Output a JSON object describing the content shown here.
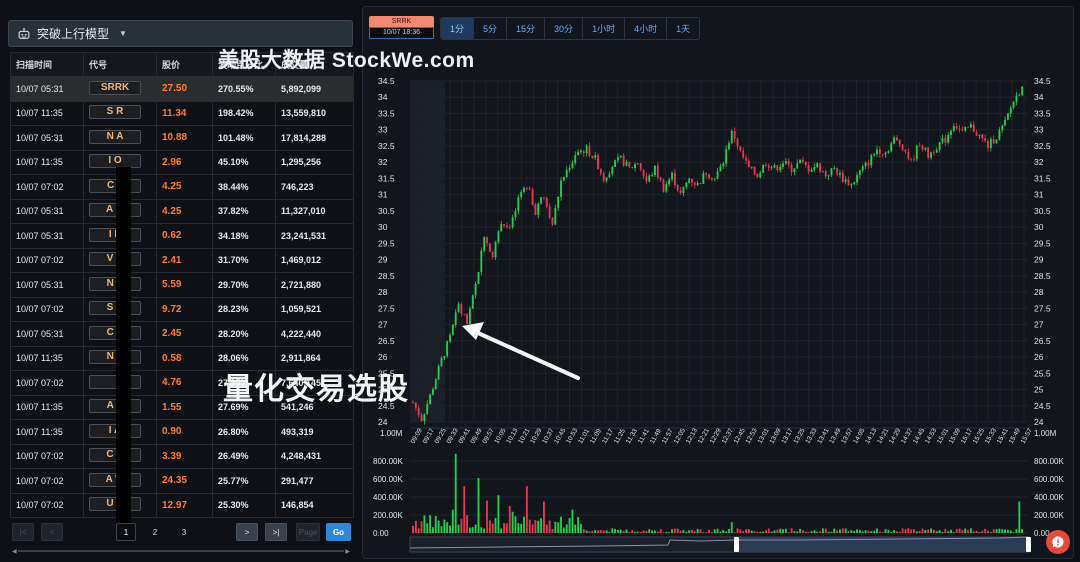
{
  "model": {
    "label": "突破上行模型",
    "icon": "robot-icon"
  },
  "table": {
    "headers": [
      "扫描时间",
      "代号",
      "股价",
      "波动百分比",
      "成交量"
    ],
    "rows": [
      {
        "time": "10/07 05:31",
        "code": "SRRK",
        "price": "27.50",
        "pct": "270.55%",
        "vol": "5,892,099"
      },
      {
        "time": "10/07 11:35",
        "code": "S    R",
        "price": "11.34",
        "pct": "198.42%",
        "vol": "13,559,810"
      },
      {
        "time": "10/07 05:31",
        "code": "N    A",
        "price": "10.88",
        "pct": "101.48%",
        "vol": "17,814,288"
      },
      {
        "time": "10/07 11:35",
        "code": "I    O",
        "price": "2.96",
        "pct": "45.10%",
        "vol": "1,295,256"
      },
      {
        "time": "10/07 07:02",
        "code": "C    T",
        "price": "4.25",
        "pct": "38.44%",
        "vol": "746,223"
      },
      {
        "time": "10/07 05:31",
        "code": "A    M",
        "price": "4.25",
        "pct": "37.82%",
        "vol": "11,327,010"
      },
      {
        "time": "10/07 05:31",
        "code": "I    E",
        "price": "0.62",
        "pct": "34.18%",
        "vol": "23,241,531"
      },
      {
        "time": "10/07 07:02",
        "code": "V    H",
        "price": "2.41",
        "pct": "31.70%",
        "vol": "1,469,012"
      },
      {
        "time": "10/07 05:31",
        "code": "N    E",
        "price": "5.59",
        "pct": "29.70%",
        "vol": "2,721,880"
      },
      {
        "time": "10/07 07:02",
        "code": "S    K",
        "price": "9.72",
        "pct": "28.23%",
        "vol": "1,059,521"
      },
      {
        "time": "10/07 05:31",
        "code": "C    V",
        "price": "2.45",
        "pct": "28.20%",
        "vol": "4,222,440"
      },
      {
        "time": "10/07 11:35",
        "code": "N    A",
        "price": "0.58",
        "pct": "28.06%",
        "vol": "2,911,864"
      },
      {
        "time": "10/07 07:02",
        "code": "",
        "price": "4.76",
        "pct": "27.95%",
        "vol": "7,640,145"
      },
      {
        "time": "10/07 11:35",
        "code": "A    N",
        "price": "1.55",
        "pct": "27.69%",
        "vol": "541,246"
      },
      {
        "time": "10/07 11:35",
        "code": "I    A",
        "price": "0.90",
        "pct": "26.80%",
        "vol": "493,319"
      },
      {
        "time": "10/07 07:02",
        "code": "C    C",
        "price": "3.39",
        "pct": "26.49%",
        "vol": "4,248,431"
      },
      {
        "time": "10/07 07:02",
        "code": "A    W",
        "price": "24.35",
        "pct": "25.77%",
        "vol": "291,477"
      },
      {
        "time": "10/07 07:02",
        "code": "U    D",
        "price": "12.97",
        "pct": "25.30%",
        "vol": "146,854"
      }
    ]
  },
  "pager": {
    "pages": [
      "1",
      "2",
      "3"
    ],
    "current": "1",
    "page_placeholder": "Page",
    "go_label": "Go",
    "first": "|<",
    "prev": "<",
    "next": ">",
    "last": ">|"
  },
  "chart_header": {
    "symbol": "SRRK",
    "timestamp": "10/07 18:36",
    "timeframes": [
      "1分",
      "5分",
      "15分",
      "30分",
      "1小时",
      "4小时",
      "1天"
    ],
    "active_timeframe": "1分",
    "title": "美股大数据 StockWe.com",
    "annotation": "量化交易选股"
  },
  "chart_data": {
    "type": "candlestick",
    "symbol": "SRRK",
    "interval": "1分",
    "price_axis": {
      "ticks": [
        "24",
        "24.5",
        "25",
        "25.5",
        "26",
        "26.5",
        "27",
        "27.5",
        "28",
        "28.5",
        "29",
        "29.5",
        "30",
        "30.5",
        "31",
        "31.5",
        "32",
        "32.5",
        "33",
        "33.5",
        "34",
        "34.5"
      ],
      "range": [
        24,
        34.5
      ]
    },
    "time_axis": [
      "09:09",
      "09:17",
      "09:25",
      "09:33",
      "09:41",
      "09:49",
      "09:57",
      "10:05",
      "10:13",
      "10:21",
      "10:29",
      "10:37",
      "10:45",
      "10:53",
      "11:01",
      "11:09",
      "11:17",
      "11:25",
      "11:33",
      "11:41",
      "11:49",
      "11:57",
      "12:05",
      "12:13",
      "12:21",
      "12:29",
      "12:37",
      "12:45",
      "12:53",
      "13:01",
      "13:09",
      "13:17",
      "13:25",
      "13:33",
      "13:41",
      "13:49",
      "13:57",
      "14:05",
      "14:13",
      "14:21",
      "14:29",
      "14:37",
      "14:45",
      "14:53",
      "15:01",
      "15:09",
      "15:17",
      "15:25",
      "15:33",
      "15:41",
      "15:49",
      "15:57"
    ],
    "volume_axis": {
      "ticks": [
        "0.00",
        "200.00K",
        "400.00K",
        "600.00K",
        "800.00K"
      ],
      "range": [
        0,
        900000
      ],
      "top_label": "1.00M"
    },
    "price_path": [
      [
        0,
        24.6
      ],
      [
        3,
        24.1
      ],
      [
        6,
        24.8
      ],
      [
        10,
        25.9
      ],
      [
        13,
        26.6
      ],
      [
        16,
        27.6
      ],
      [
        19,
        27.0
      ],
      [
        22,
        28.2
      ],
      [
        25,
        29.8
      ],
      [
        28,
        29.1
      ],
      [
        31,
        30.2
      ],
      [
        34,
        29.9
      ],
      [
        37,
        30.8
      ],
      [
        40,
        31.3
      ],
      [
        43,
        30.5
      ],
      [
        46,
        31.0
      ],
      [
        49,
        30.1
      ],
      [
        52,
        31.4
      ],
      [
        55,
        31.9
      ],
      [
        58,
        32.3
      ],
      [
        61,
        32.4
      ],
      [
        64,
        32.1
      ],
      [
        67,
        31.5
      ],
      [
        70,
        31.9
      ],
      [
        73,
        32.1
      ],
      [
        76,
        31.8
      ],
      [
        79,
        32.0
      ],
      [
        82,
        31.4
      ],
      [
        85,
        31.8
      ],
      [
        88,
        31.2
      ],
      [
        91,
        31.6
      ],
      [
        94,
        31.0
      ],
      [
        97,
        31.5
      ],
      [
        100,
        31.3
      ],
      [
        103,
        31.7
      ],
      [
        106,
        31.5
      ],
      [
        109,
        32.0
      ],
      [
        112,
        33.0
      ],
      [
        115,
        32.3
      ],
      [
        118,
        31.8
      ],
      [
        121,
        31.6
      ],
      [
        124,
        32.0
      ],
      [
        127,
        31.8
      ],
      [
        130,
        32.0
      ],
      [
        133,
        31.8
      ],
      [
        136,
        32.0
      ],
      [
        139,
        31.8
      ],
      [
        142,
        31.9
      ],
      [
        145,
        31.6
      ],
      [
        148,
        31.8
      ],
      [
        151,
        31.5
      ],
      [
        154,
        31.3
      ],
      [
        157,
        31.7
      ],
      [
        160,
        32.0
      ],
      [
        163,
        32.4
      ],
      [
        166,
        32.3
      ],
      [
        169,
        32.7
      ],
      [
        172,
        32.5
      ],
      [
        175,
        32.0
      ],
      [
        178,
        32.6
      ],
      [
        181,
        32.2
      ],
      [
        184,
        32.5
      ],
      [
        187,
        32.7
      ],
      [
        190,
        33.2
      ],
      [
        193,
        32.9
      ],
      [
        196,
        33.1
      ],
      [
        199,
        32.8
      ],
      [
        202,
        32.5
      ],
      [
        205,
        32.8
      ],
      [
        208,
        33.2
      ],
      [
        211,
        33.9
      ],
      [
        214,
        34.3
      ]
    ],
    "volume_spikes": [
      [
        15,
        880000
      ],
      [
        18,
        520000
      ],
      [
        23,
        610000
      ],
      [
        26,
        360000
      ],
      [
        30,
        420000
      ],
      [
        34,
        300000
      ],
      [
        40,
        520000
      ],
      [
        46,
        350000
      ],
      [
        56,
        260000
      ],
      [
        112,
        120000
      ],
      [
        213,
        350000
      ]
    ],
    "colors": {
      "up": "#1fd14f",
      "down": "#e8384f",
      "background": "#12151b",
      "grid": "#1e232b",
      "axis_text": "#e0e3e8"
    },
    "grid": true,
    "navigator": true
  },
  "fab": {
    "icon": "chat-icon"
  }
}
